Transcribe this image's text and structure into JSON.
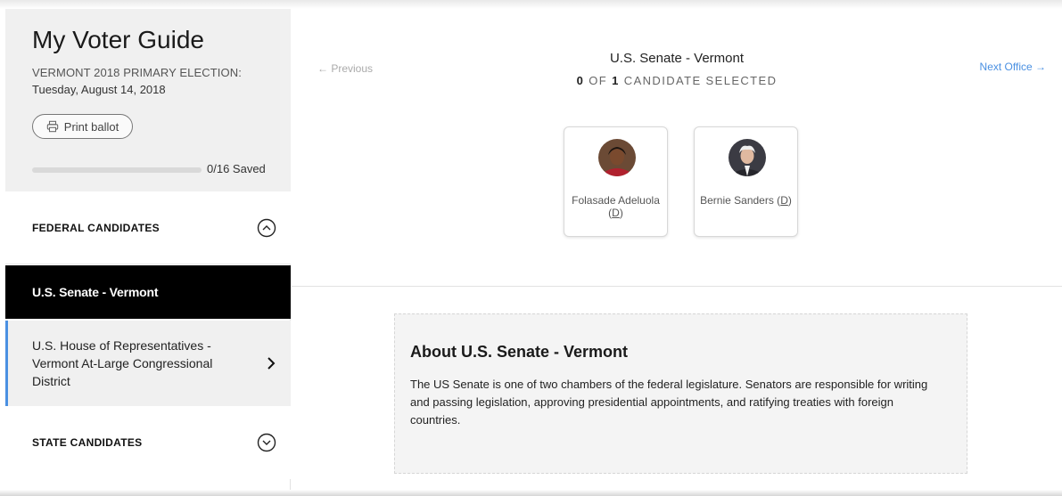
{
  "sidebar": {
    "title": "My Voter Guide",
    "election_label": "VERMONT 2018 PRIMARY ELECTION:",
    "election_date": "Tuesday, August 14, 2018",
    "print_label": "Print ballot",
    "progress_text": "0/16 Saved",
    "progress_fraction": 0,
    "sections": {
      "federal": "FEDERAL CANDIDATES",
      "state": "STATE CANDIDATES"
    },
    "items": [
      {
        "label": "U.S. Senate - Vermont",
        "active": true
      },
      {
        "label": "U.S. House of Representatives - Vermont At-Large Congressional District",
        "active": false
      }
    ]
  },
  "main": {
    "prev_label": "← Previous",
    "next_label": "Next Office →",
    "office_title": "U.S. Senate - Vermont",
    "selected_count": "0",
    "selected_of": "OF",
    "selected_total": "1",
    "selected_suffix": "CANDIDATE SELECTED",
    "candidates": [
      {
        "name": "Folasade Adeluola",
        "party": "D"
      },
      {
        "name": "Bernie Sanders",
        "party": "D"
      }
    ],
    "about": {
      "title": "About U.S. Senate - Vermont",
      "text": "The US Senate is one of two chambers of the federal legislature. Senators are responsible for writing and passing legislation, approving presidential appointments, and ratifying treaties with foreign countries."
    }
  },
  "colors": {
    "accent": "#4a90e2",
    "active_bg": "#000000",
    "sidebar_bg": "#f0f0f0"
  },
  "icons": [
    "printer-icon",
    "chevron-up-circle-icon",
    "chevron-down-circle-icon",
    "chevron-right-icon",
    "arrow-left-icon",
    "arrow-right-icon"
  ]
}
